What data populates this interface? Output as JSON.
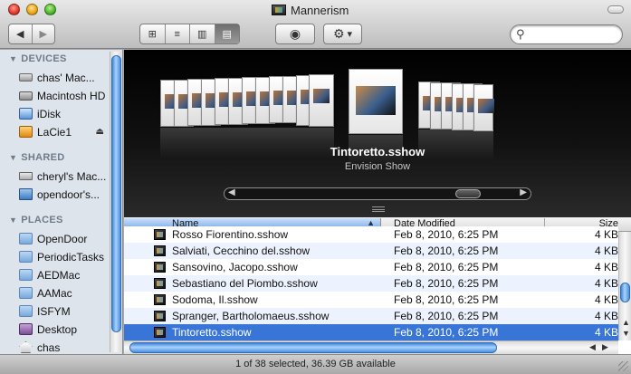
{
  "window": {
    "title": "Mannerism"
  },
  "toolbar": {
    "back_icon": "◀",
    "forward_icon": "▶",
    "view_icons": [
      "⊞",
      "≡",
      "▥",
      "▤"
    ],
    "quicklook_icon": "◉",
    "action_icon": "⚙",
    "action_caret": "▾",
    "search_icon": "⚲",
    "search_placeholder": ""
  },
  "sidebar": {
    "sections": [
      {
        "header": "DEVICES",
        "items": [
          {
            "label": "chas' Mac...",
            "icon": "computer-icon"
          },
          {
            "label": "Macintosh HD",
            "icon": "hard-drive-icon"
          },
          {
            "label": "iDisk",
            "icon": "idisk-icon"
          },
          {
            "label": "LaCie1",
            "icon": "external-drive-icon",
            "eject": "⏏"
          }
        ]
      },
      {
        "header": "SHARED",
        "items": [
          {
            "label": "cheryl's Mac...",
            "icon": "shared-computer-icon"
          },
          {
            "label": "opendoor's...",
            "icon": "shared-screen-icon"
          }
        ]
      },
      {
        "header": "PLACES",
        "items": [
          {
            "label": "OpenDoor",
            "icon": "folder-icon"
          },
          {
            "label": "PeriodicTasks",
            "icon": "folder-icon"
          },
          {
            "label": "AEDMac",
            "icon": "folder-icon"
          },
          {
            "label": "AAMac",
            "icon": "folder-icon"
          },
          {
            "label": "ISFYM",
            "icon": "folder-icon"
          },
          {
            "label": "Desktop",
            "icon": "desktop-icon"
          },
          {
            "label": "chas",
            "icon": "home-icon"
          }
        ]
      }
    ]
  },
  "coverflow": {
    "selected_name": "Tintoretto.sshow",
    "selected_kind": "Envision Show"
  },
  "list": {
    "columns": {
      "name": "Name",
      "date": "Date Modified",
      "size": "Size"
    },
    "sort_indicator": "▲",
    "rows": [
      {
        "name": "Rosso Fiorentino.sshow",
        "date": "Feb 8, 2010, 6:25 PM",
        "size": "4 KB",
        "selected": false
      },
      {
        "name": "Salviati, Cecchino del.sshow",
        "date": "Feb 8, 2010, 6:25 PM",
        "size": "4 KB",
        "selected": false
      },
      {
        "name": "Sansovino, Jacopo.sshow",
        "date": "Feb 8, 2010, 6:25 PM",
        "size": "4 KB",
        "selected": false
      },
      {
        "name": "Sebastiano del Piombo.sshow",
        "date": "Feb 8, 2010, 6:25 PM",
        "size": "4 KB",
        "selected": false
      },
      {
        "name": "Sodoma, Il.sshow",
        "date": "Feb 8, 2010, 6:25 PM",
        "size": "4 KB",
        "selected": false
      },
      {
        "name": "Spranger, Bartholomaeus.sshow",
        "date": "Feb 8, 2010, 6:25 PM",
        "size": "4 KB",
        "selected": false
      },
      {
        "name": "Tintoretto.sshow",
        "date": "Feb 8, 2010, 6:25 PM",
        "size": "4 KB",
        "selected": true
      }
    ]
  },
  "status": {
    "text": "1 of 38 selected, 36.39 GB available"
  }
}
